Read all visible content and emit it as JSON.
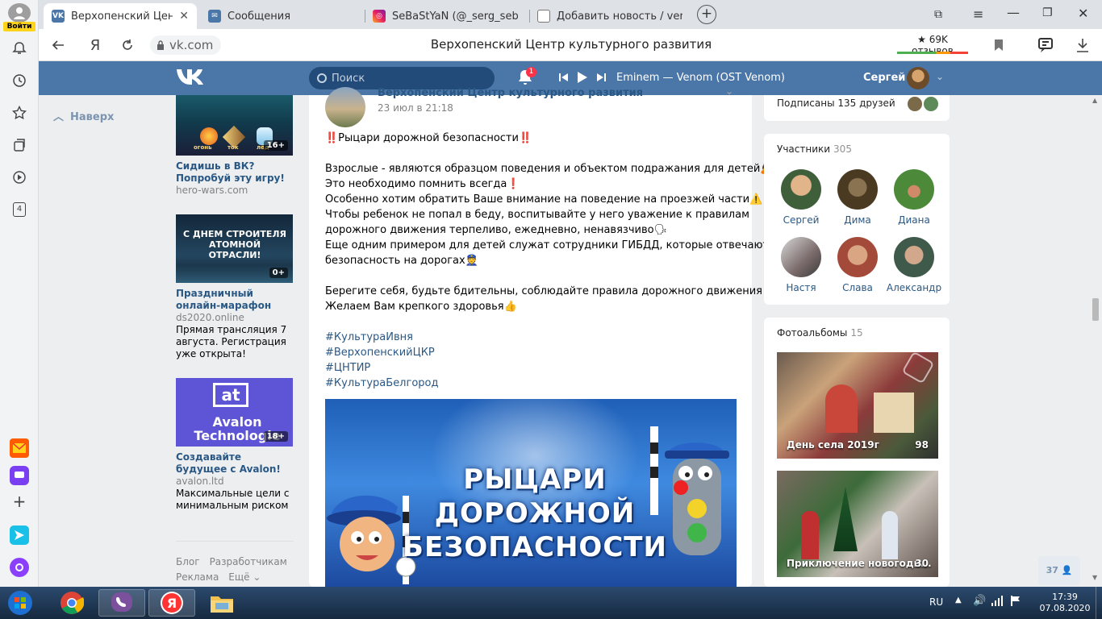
{
  "browser": {
    "login_badge": "Войти",
    "tabs": [
      {
        "label": "Верхопенский Центр к",
        "active": true
      },
      {
        "label": "Сообщения"
      },
      {
        "label": "SeBaStYaN (@_serg_sebast"
      },
      {
        "label": "Добавить новость / verho"
      }
    ],
    "url": "vk.com",
    "page_heading": "Верхопенский Центр культурного развития",
    "reviews": "★ 69K отзывов",
    "side_badge": "4"
  },
  "vk": {
    "search_placeholder": "Поиск",
    "notifications_count": "1",
    "track": "Eminem — Venom (OST Venom)",
    "user_name": "Сергей"
  },
  "left_nav": {
    "up_label": "Наверх"
  },
  "ads": [
    {
      "title": "Сидишь в ВК? Попробуй эту игру!",
      "domain": "hero-wars.com",
      "description": "",
      "age": "16+",
      "image_labels": [
        "огонь",
        "ток",
        "лёд"
      ]
    },
    {
      "title": "Праздничный онлайн-марафон",
      "domain": "ds2020.online",
      "description": "Прямая трансляция 7 августа. Регистрация уже открыта!",
      "age": "0+",
      "image_text": "С ДНЕМ СТРОИТЕЛЯ АТОМНОЙ ОТРАСЛИ!"
    },
    {
      "title": "Создавайте будущее с Avalon!",
      "domain": "avalon.ltd",
      "description": "Максимальные цели с минимальным риском",
      "age": "18+",
      "image_logo": "at",
      "image_text": "Avalon Technologie"
    }
  ],
  "footer_links": [
    "Блог",
    "Разработчикам",
    "Реклама",
    "Ещё ⌄"
  ],
  "post": {
    "author": "Верхопенский Центр культурного развития",
    "date": "23 июл в 21:18",
    "lines": [
      "‼️Рыцари дорожной безопасности‼️",
      "",
      "Взрослые - являются образцом поведения и объектом подражания для детей🙇",
      "Это необходимо помнить всегда❗",
      "Особенно хотим обратить Ваше внимание на поведение на проезжей части⚠️",
      "Чтобы ребенок не попал в беду, воспитывайте у него уважение к правилам",
      "дорожного движения терпеливо, ежедневно, ненавязчиво🗣",
      "Еще одним примером для детей служат сотрудники ГИБДД, которые отвечают за",
      "безопасность на дорогах👮",
      "",
      "Берегите себя, будьте бдительны, соблюдайте правила дорожного движения🙏",
      "Желаем Вам крепкого здоровья👍"
    ],
    "hashtags": [
      "#КультураИвня",
      "#ВерхопенскийЦКР",
      "#ЦНТИР",
      "#КультураБелгород"
    ],
    "banner_lines": [
      "РЫЦАРИ",
      "ДОРОЖНОЙ",
      "БЕЗОПАСНОСТИ"
    ]
  },
  "friends": {
    "text": "Подписаны 135 друзей"
  },
  "members": {
    "title": "Участники",
    "count": "305",
    "people": [
      {
        "name": "Сергей",
        "color": "#c99a6e"
      },
      {
        "name": "Дима",
        "color": "#6b5a3a"
      },
      {
        "name": "Диана",
        "color": "#5f8a3e"
      },
      {
        "name": "Настя",
        "color": "#9a9a9a"
      },
      {
        "name": "Слава",
        "color": "#b06a55"
      },
      {
        "name": "Александр",
        "color": "#4f6a57"
      }
    ]
  },
  "albums": {
    "title": "Фотоальбомы",
    "count": "15",
    "items": [
      {
        "title": "День села 2019г",
        "count": "98"
      },
      {
        "title": "Приключение новогодн...",
        "count": "30"
      }
    ]
  },
  "online_count": "37",
  "taskbar": {
    "lang": "RU",
    "time": "17:39",
    "date": "07.08.2020"
  }
}
